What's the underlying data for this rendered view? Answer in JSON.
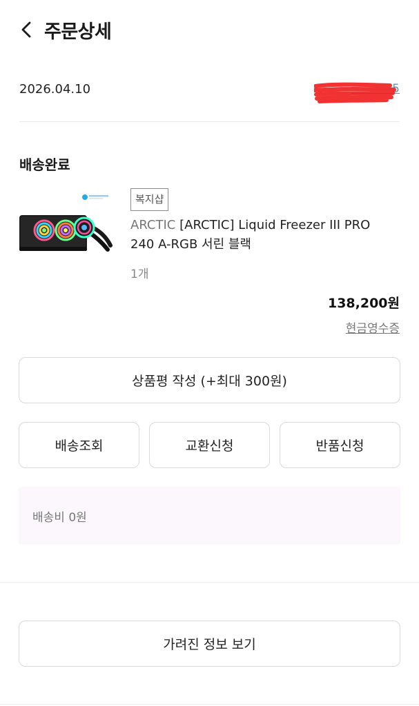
{
  "header": {
    "title": "주문상세",
    "back_icon": "chevron-left-icon"
  },
  "order": {
    "date": "2026.04.10"
  },
  "delivery": {
    "status": "배송완료"
  },
  "product": {
    "shop_badge": "복지샵",
    "brand": "ARCTIC",
    "name": "[ARCTIC] Liquid Freezer III PRO 240 A-RGB 서린 블랙",
    "quantity": "1개",
    "price": "138,200원",
    "receipt_link": "현금영수증"
  },
  "actions": {
    "review": "상품평 작성 (+최대 300원)",
    "track": "배송조회",
    "exchange": "교환신청",
    "return": "반품신청"
  },
  "shipping": {
    "fee": "배송비 0원"
  },
  "footer": {
    "hidden_info": "가려진 정보 보기"
  },
  "colors": {
    "redaction": "#ee1c1c",
    "shipping_box": "#fcf7fc",
    "button_border": "#d9d9d9"
  }
}
